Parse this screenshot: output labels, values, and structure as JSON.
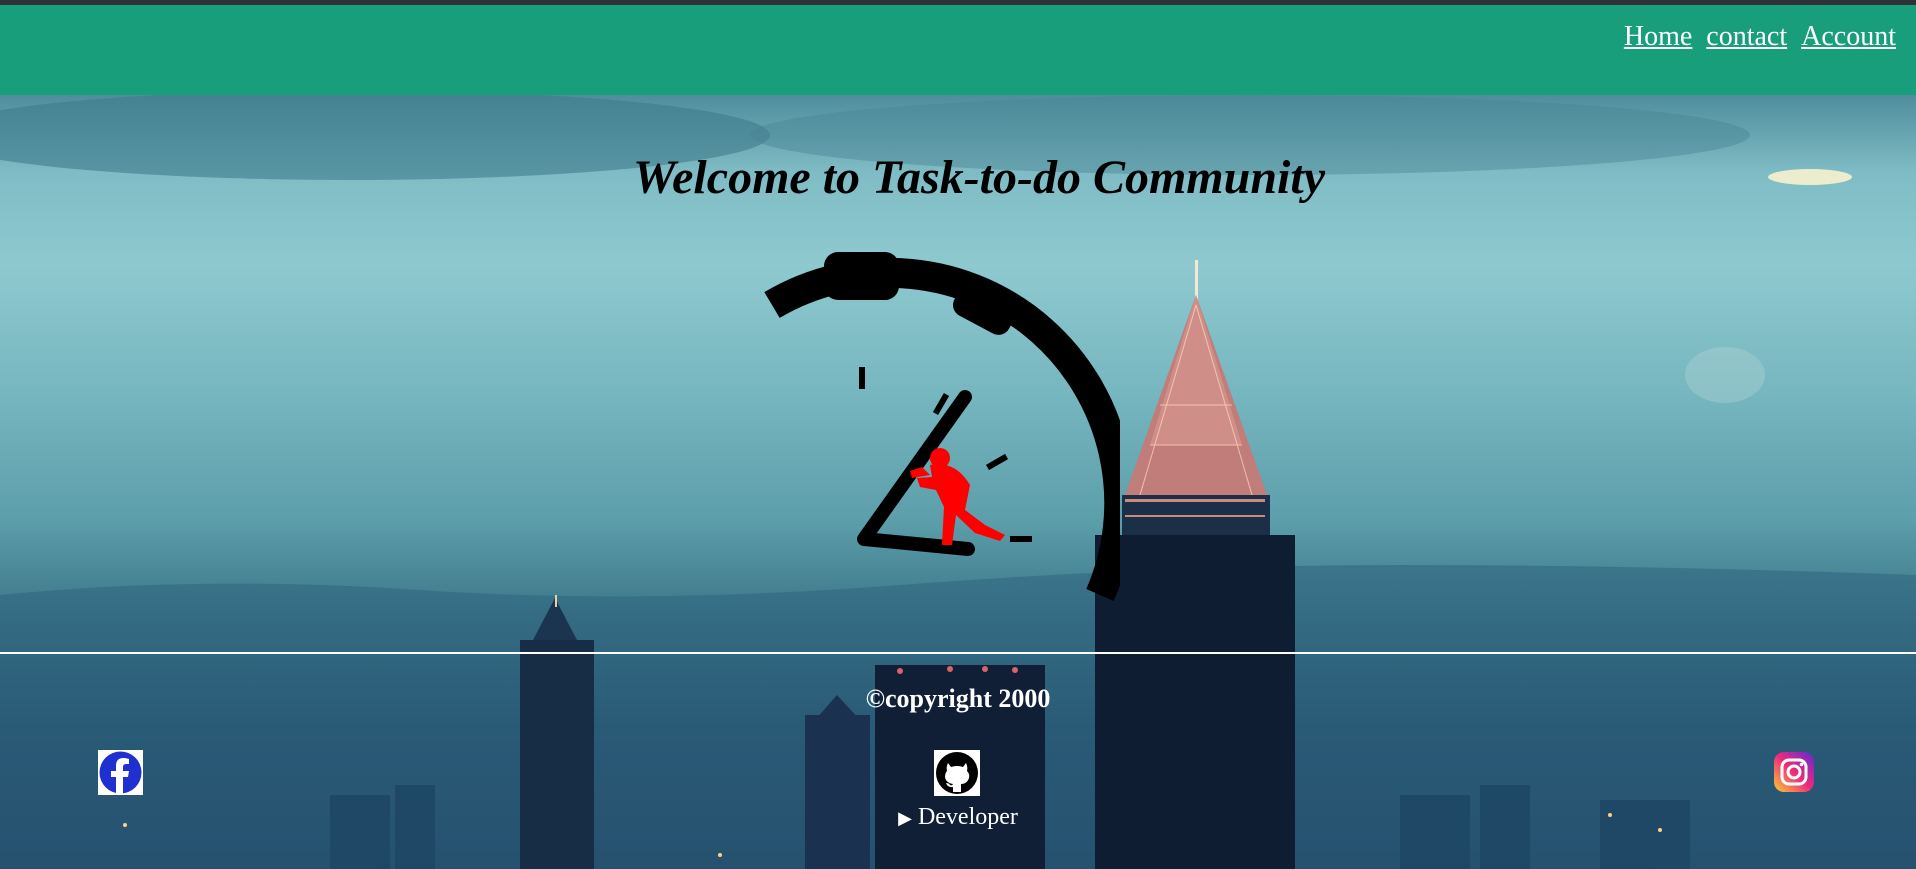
{
  "nav": {
    "links": [
      {
        "label": "Home"
      },
      {
        "label": "contact"
      },
      {
        "label": "Account"
      }
    ]
  },
  "hero": {
    "title": "Welcome to Task-to-do Community"
  },
  "footer": {
    "copyright": "©copyright 2000",
    "developer_label": "Developer",
    "social_icons": [
      "facebook-icon",
      "github-icon",
      "instagram-icon"
    ]
  },
  "colors": {
    "header_bg": "#199e7c",
    "logo_figure": "#ff0000",
    "text_light": "#ffffff"
  }
}
